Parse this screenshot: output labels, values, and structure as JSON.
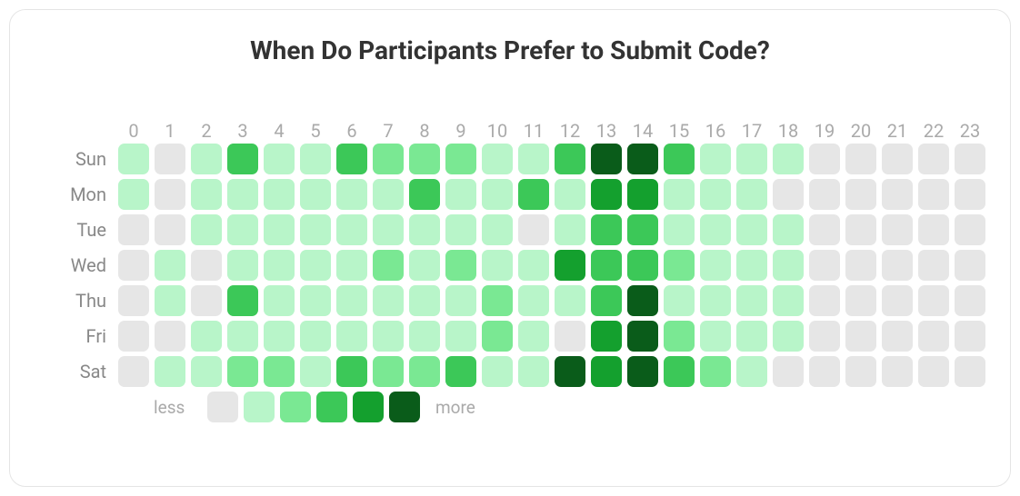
{
  "title": "When Do Participants Prefer to Submit Code?",
  "legend": {
    "less": "less",
    "more": "more"
  },
  "chart_data": {
    "type": "heatmap",
    "xlabel": "",
    "ylabel": "",
    "hours": [
      "0",
      "1",
      "2",
      "3",
      "4",
      "5",
      "6",
      "7",
      "8",
      "9",
      "10",
      "11",
      "12",
      "13",
      "14",
      "15",
      "16",
      "17",
      "18",
      "19",
      "20",
      "21",
      "22",
      "23"
    ],
    "days": [
      "Sun",
      "Mon",
      "Tue",
      "Wed",
      "Thu",
      "Fri",
      "Sat"
    ],
    "intensity_levels": [
      0,
      1,
      2,
      3,
      4,
      5
    ],
    "colors": {
      "0": "#e6e6e6",
      "1": "#b8f5c9",
      "2": "#7ae893",
      "3": "#3cc858",
      "4": "#14a02e",
      "5": "#0a5c1a"
    },
    "values": [
      [
        1,
        0,
        1,
        3,
        1,
        1,
        3,
        2,
        2,
        2,
        1,
        1,
        3,
        5,
        5,
        3,
        1,
        1,
        1,
        0,
        0,
        0,
        0,
        0
      ],
      [
        1,
        0,
        1,
        1,
        1,
        1,
        1,
        1,
        3,
        1,
        1,
        3,
        1,
        4,
        4,
        1,
        1,
        1,
        0,
        0,
        0,
        0,
        0,
        0
      ],
      [
        0,
        0,
        1,
        1,
        1,
        1,
        1,
        1,
        1,
        1,
        1,
        0,
        1,
        3,
        3,
        1,
        1,
        1,
        1,
        0,
        0,
        0,
        0,
        0
      ],
      [
        0,
        1,
        0,
        1,
        1,
        1,
        1,
        2,
        1,
        2,
        1,
        1,
        4,
        3,
        3,
        2,
        1,
        1,
        1,
        0,
        0,
        0,
        0,
        0
      ],
      [
        0,
        1,
        0,
        3,
        1,
        1,
        1,
        1,
        1,
        1,
        2,
        1,
        1,
        3,
        5,
        1,
        1,
        1,
        1,
        0,
        0,
        0,
        0,
        0
      ],
      [
        0,
        0,
        1,
        1,
        1,
        1,
        1,
        1,
        1,
        1,
        2,
        1,
        0,
        4,
        5,
        2,
        1,
        1,
        1,
        0,
        0,
        0,
        0,
        0
      ],
      [
        0,
        1,
        1,
        2,
        2,
        1,
        3,
        2,
        2,
        3,
        1,
        1,
        5,
        4,
        5,
        3,
        2,
        1,
        0,
        0,
        0,
        0,
        0,
        0
      ]
    ]
  }
}
